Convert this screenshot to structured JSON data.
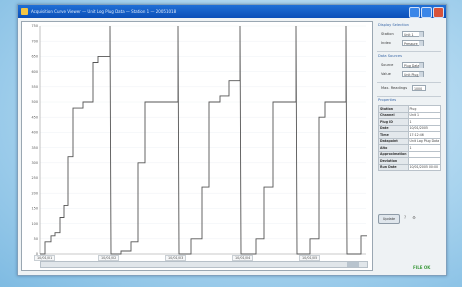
{
  "window": {
    "title": "Acquisition Curve Viewer — Unit Log Plug Data — Station 1 — 20051018"
  },
  "plot": {
    "y_ticks": [
      "750",
      "700",
      "650",
      "600",
      "550",
      "500",
      "450",
      "400",
      "350",
      "300",
      "250",
      "200",
      "150",
      "100",
      "50",
      "0"
    ],
    "x_ticks": [
      "10/01/01",
      "10/01/02",
      "10/01/03",
      "10/01/04",
      "10/01/05"
    ]
  },
  "chart_data": {
    "type": "line",
    "ylim": [
      0,
      750
    ],
    "series": [
      {
        "values": [
          [
            0,
            0
          ],
          [
            5,
            0
          ],
          [
            5,
            40
          ],
          [
            11,
            40
          ],
          [
            11,
            60
          ],
          [
            15,
            60
          ],
          [
            15,
            70
          ],
          [
            20,
            70
          ],
          [
            20,
            120
          ],
          [
            24,
            120
          ],
          [
            24,
            160
          ],
          [
            28,
            160
          ],
          [
            28,
            320
          ],
          [
            33,
            320
          ],
          [
            33,
            480
          ],
          [
            43,
            480
          ],
          [
            43,
            500
          ],
          [
            53,
            500
          ],
          [
            53,
            630
          ],
          [
            58,
            630
          ],
          [
            58,
            650
          ],
          [
            70,
            650
          ],
          [
            70,
            770
          ],
          [
            71,
            0
          ],
          [
            81,
            0
          ],
          [
            81,
            10
          ],
          [
            91,
            10
          ],
          [
            91,
            40
          ],
          [
            98,
            40
          ],
          [
            98,
            300
          ],
          [
            105,
            300
          ],
          [
            105,
            500
          ],
          [
            138,
            500
          ],
          [
            138,
            750
          ],
          [
            139,
            0
          ],
          [
            151,
            0
          ],
          [
            151,
            50
          ],
          [
            162,
            50
          ],
          [
            162,
            220
          ],
          [
            169,
            220
          ],
          [
            169,
            500
          ],
          [
            180,
            500
          ],
          [
            180,
            520
          ],
          [
            189,
            520
          ],
          [
            189,
            570
          ],
          [
            200,
            570
          ],
          [
            200,
            770
          ],
          [
            201,
            0
          ],
          [
            216,
            0
          ],
          [
            216,
            50
          ],
          [
            224,
            50
          ],
          [
            224,
            220
          ],
          [
            233,
            220
          ],
          [
            233,
            500
          ],
          [
            256,
            500
          ],
          [
            256,
            770
          ],
          [
            257,
            0
          ],
          [
            270,
            0
          ],
          [
            270,
            50
          ],
          [
            279,
            50
          ],
          [
            279,
            450
          ],
          [
            285,
            450
          ],
          [
            285,
            500
          ],
          [
            306,
            500
          ],
          [
            306,
            750
          ],
          [
            307,
            0
          ],
          [
            321,
            0
          ],
          [
            321,
            60
          ],
          [
            327,
            60
          ]
        ]
      }
    ]
  },
  "panel": {
    "display_title": "Display Selection",
    "station_label": "Station",
    "station_value": "Unit 1",
    "index_label": "Index",
    "index_value": "Pressure",
    "data_sources_title": "Data Sources",
    "source_label": "Source",
    "source_value": "Plug Data",
    "value_label": "Value",
    "value_value": "Unit Plug",
    "max_readings_label": "Max. Readings",
    "max_readings_value": "1000",
    "properties_title": "Properties",
    "properties": [
      [
        "Station",
        "Plug"
      ],
      [
        "Channel",
        "Unit 1"
      ],
      [
        "Plug ID",
        "1"
      ],
      [
        "Date",
        "10/01/2005"
      ],
      [
        "Time",
        "17:12:46"
      ],
      [
        "Datapoint",
        "Unit Log Plug Data"
      ],
      [
        "Alto",
        "1"
      ],
      [
        "Approximation",
        ""
      ],
      [
        "Deviation",
        ""
      ],
      [
        "Run Date",
        "10/01/2005 00:00"
      ]
    ],
    "update_label": "Update",
    "status_text": "FILE OK"
  }
}
